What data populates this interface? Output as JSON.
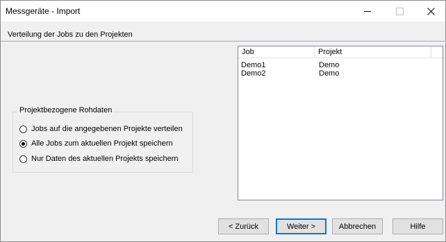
{
  "window": {
    "title": "Messgeräte - Import",
    "controls": {
      "minimize_icon": "minimize-icon",
      "maximize_icon": "maximize-icon",
      "close_icon": "close-icon"
    }
  },
  "header": {
    "subtitle": "Verteilung der Jobs zu den Projekten"
  },
  "group": {
    "legend": "Projektbezogene Rohdaten",
    "options": [
      {
        "label": "Jobs auf die angegebenen Projekte verteilen",
        "checked": false
      },
      {
        "label": "Alle Jobs zum aktuellen Projekt speichern",
        "checked": true
      },
      {
        "label": "Nur Daten des aktuellen Projekts speichern",
        "checked": false
      }
    ]
  },
  "list": {
    "columns": [
      "Job",
      "Projekt"
    ],
    "rows": [
      [
        "Demo1",
        "Demo"
      ],
      [
        "Demo2",
        "Demo"
      ]
    ]
  },
  "buttons": {
    "back": "< Zurück",
    "next": "Weiter >",
    "cancel": "Abbrechen",
    "help": "Hilfe"
  },
  "colors": {
    "window_bg": "#f0f0f0",
    "titlebar_bg": "#ffffff",
    "default_button_border": "#0078d7"
  }
}
